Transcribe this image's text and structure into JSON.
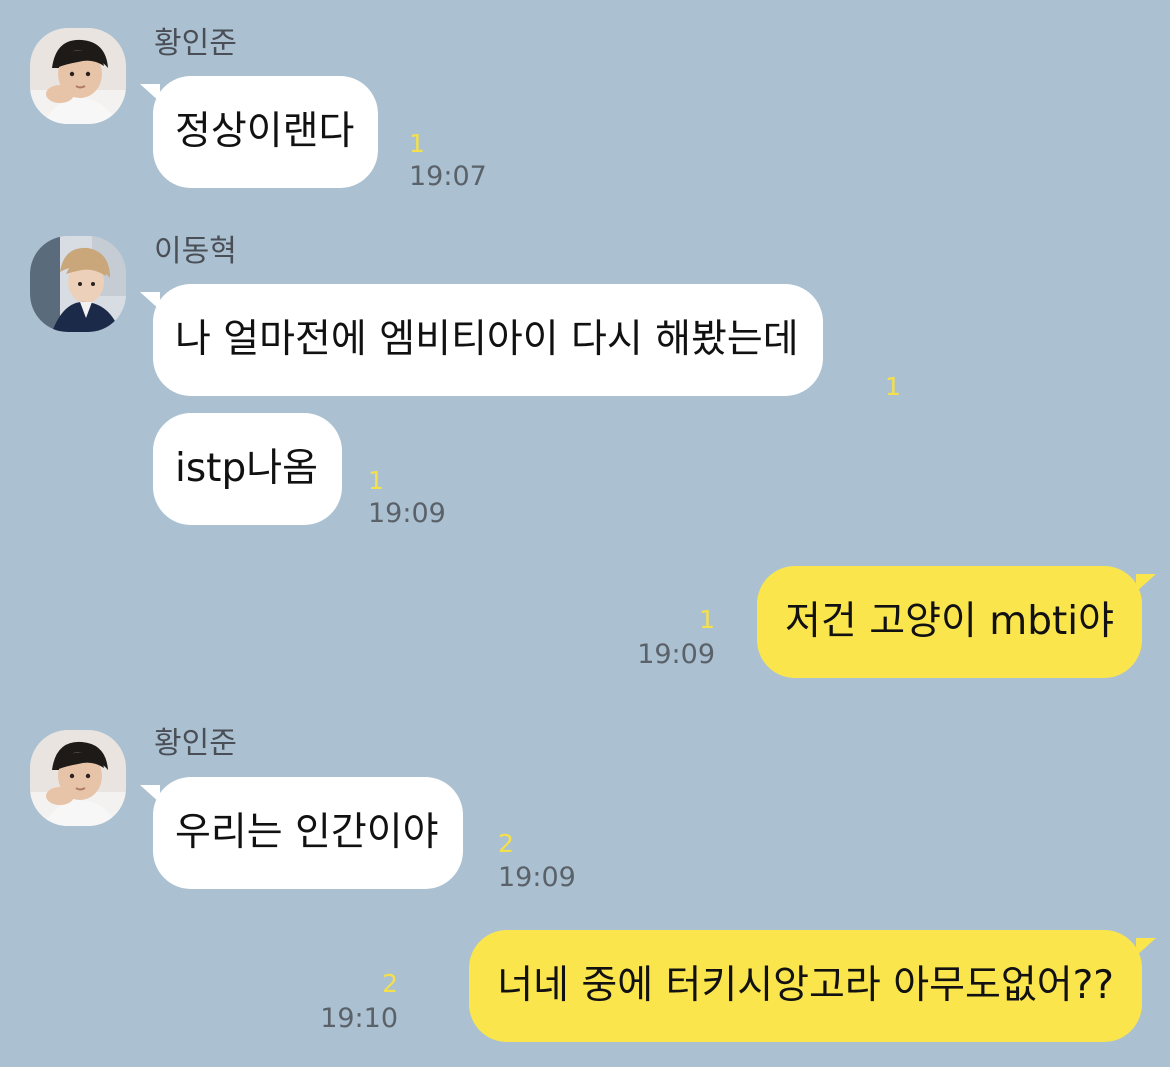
{
  "colors": {
    "background": "#abc1d1",
    "incoming_bubble": "#ffffff",
    "outgoing_bubble": "#fae54d",
    "unread_count": "#f4e04b",
    "timestamp": "#5b6169",
    "sender_name": "#4a4f57"
  },
  "messages": [
    {
      "sender": "황인준",
      "text": "정상이랜다",
      "unread": "1",
      "time": "19:07"
    },
    {
      "sender": "이동혁",
      "text": "나 얼마전에 엠비티아이 다시 해봤는데",
      "unread": "1",
      "time": ""
    },
    {
      "sender": "",
      "text": "istp나옴",
      "unread": "1",
      "time": "19:09"
    },
    {
      "sender": "",
      "text": "저건 고양이 mbti야",
      "unread": "1",
      "time": "19:09",
      "outgoing": true
    },
    {
      "sender": "황인준",
      "text": "우리는 인간이야",
      "unread": "2",
      "time": "19:09"
    },
    {
      "sender": "",
      "text": "너네 중에 터키시앙고라 아무도없어??",
      "unread": "2",
      "time": "19:10",
      "outgoing": true
    }
  ],
  "avatars": [
    {
      "icon": "profile-photo-icon"
    },
    {
      "icon": "profile-photo-icon"
    },
    {
      "icon": "profile-photo-icon"
    }
  ]
}
